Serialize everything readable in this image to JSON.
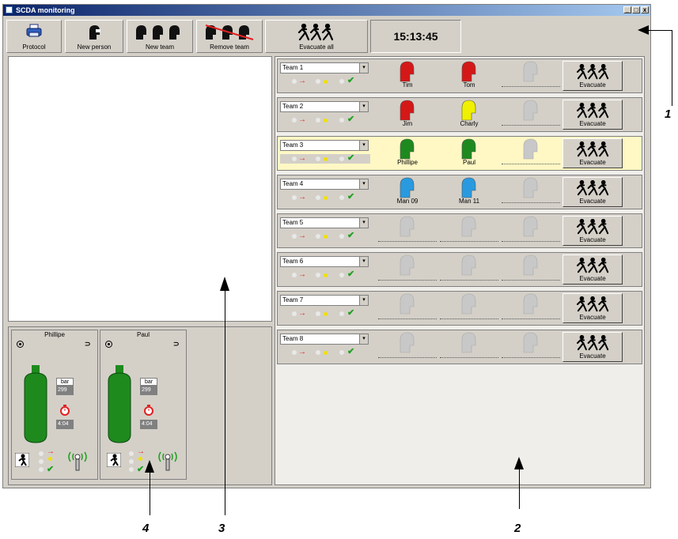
{
  "window": {
    "title": "SCDA monitoring",
    "controls": [
      "_",
      "□",
      "x"
    ]
  },
  "toolbar": {
    "protocol": "Protocol",
    "new_person": "New person",
    "new_team": "New team",
    "remove_team": "Remove team",
    "evacuate_all": "Evacuate all",
    "clock": "15:13:45"
  },
  "teams": [
    {
      "name": "Team 1",
      "members": [
        {
          "name": "Tim",
          "color": "#d41818"
        },
        {
          "name": "Tom",
          "color": "#d41818"
        },
        {
          "name": "",
          "color": "#c8c8c8"
        }
      ],
      "highlight": false
    },
    {
      "name": "Team 2",
      "members": [
        {
          "name": "Jim",
          "color": "#d41818"
        },
        {
          "name": "Charly",
          "color": "#f0f000"
        },
        {
          "name": "",
          "color": "#c8c8c8"
        }
      ],
      "highlight": false
    },
    {
      "name": "Team 3",
      "members": [
        {
          "name": "Phillipe",
          "color": "#1e8a1e"
        },
        {
          "name": "Paul",
          "color": "#1e8a1e"
        },
        {
          "name": "",
          "color": "#c8c8c8"
        }
      ],
      "highlight": true
    },
    {
      "name": "Team 4",
      "members": [
        {
          "name": "Man 09",
          "color": "#2a9ae0"
        },
        {
          "name": "Man 11",
          "color": "#2a9ae0"
        },
        {
          "name": "",
          "color": "#c8c8c8"
        }
      ],
      "highlight": false
    },
    {
      "name": "Team 5",
      "members": [
        {
          "name": "",
          "color": "#c8c8c8"
        },
        {
          "name": "",
          "color": "#c8c8c8"
        },
        {
          "name": "",
          "color": "#c8c8c8"
        }
      ],
      "highlight": false
    },
    {
      "name": "Team 6",
      "members": [
        {
          "name": "",
          "color": "#c8c8c8"
        },
        {
          "name": "",
          "color": "#c8c8c8"
        },
        {
          "name": "",
          "color": "#c8c8c8"
        }
      ],
      "highlight": false
    },
    {
      "name": "Team 7",
      "members": [
        {
          "name": "",
          "color": "#c8c8c8"
        },
        {
          "name": "",
          "color": "#c8c8c8"
        },
        {
          "name": "",
          "color": "#c8c8c8"
        }
      ],
      "highlight": false
    },
    {
      "name": "Team 8",
      "members": [
        {
          "name": "",
          "color": "#c8c8c8"
        },
        {
          "name": "",
          "color": "#c8c8c8"
        },
        {
          "name": "",
          "color": "#c8c8c8"
        }
      ],
      "highlight": false
    }
  ],
  "evacuate_label": "Evacuate",
  "persons": [
    {
      "name": "Phillipe",
      "unit": "bar",
      "pressure": "299",
      "time": "4:04"
    },
    {
      "name": "Paul",
      "unit": "bar",
      "pressure": "299",
      "time": "4:04"
    }
  ],
  "callouts": [
    "1",
    "2",
    "3",
    "4"
  ],
  "colors": {
    "cylinder": "#1e8a1e",
    "alarm_arrow": "#e02020",
    "warning_dot": "#f0e000",
    "ok_check": "#20a020"
  }
}
